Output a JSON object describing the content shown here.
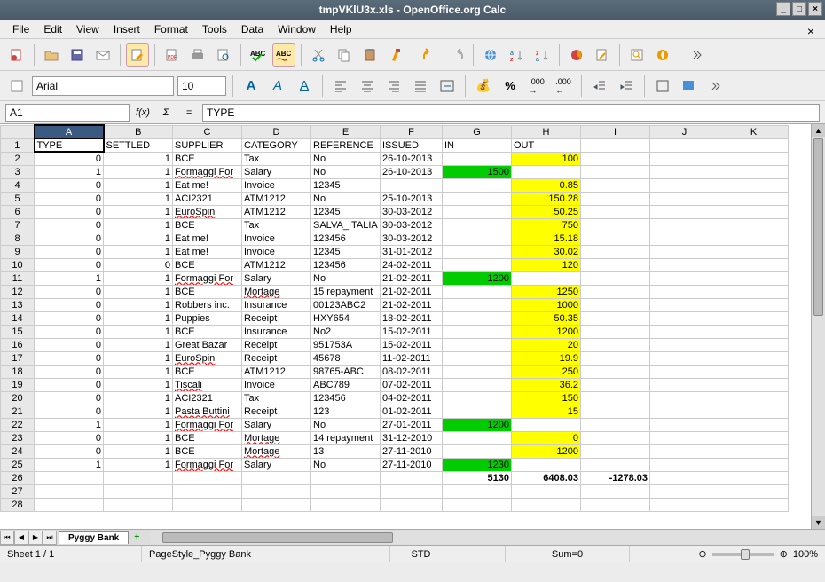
{
  "window": {
    "title": "tmpVKlU3x.xls - OpenOffice.org Calc"
  },
  "menu": {
    "file": "File",
    "edit": "Edit",
    "view": "View",
    "insert": "Insert",
    "format": "Format",
    "tools": "Tools",
    "data": "Data",
    "window": "Window",
    "help": "Help"
  },
  "format": {
    "font": "Arial",
    "size": "10"
  },
  "formula": {
    "ref": "A1",
    "value": "TYPE"
  },
  "cols": [
    "A",
    "B",
    "C",
    "D",
    "E",
    "F",
    "G",
    "H",
    "I",
    "J",
    "K"
  ],
  "headers": {
    "A": "TYPE",
    "B": "SETTLED",
    "C": "SUPPLIER",
    "D": "CATEGORY",
    "E": "REFERENCE",
    "F": "ISSUED",
    "G": "IN",
    "H": "OUT"
  },
  "rows": [
    {
      "n": 2,
      "A": "0",
      "B": "1",
      "C": "BCE",
      "D": "Tax",
      "E": "No",
      "F": "26-10-2013",
      "H": "100",
      "Hc": "yellow"
    },
    {
      "n": 3,
      "A": "1",
      "B": "1",
      "C": "Formaggi For",
      "D": "Salary",
      "E": "No",
      "F": "26-10-2013",
      "G": "1500",
      "Gc": "green",
      "Cspell": true
    },
    {
      "n": 4,
      "A": "0",
      "B": "1",
      "C": "Eat me!",
      "D": "Invoice",
      "E": "12345",
      "H": "0.85",
      "Hc": "yellow"
    },
    {
      "n": 5,
      "A": "0",
      "B": "1",
      "C": "ACI2321",
      "D": "ATM1212",
      "E": "No",
      "F": "25-10-2013",
      "H": "150.28",
      "Hc": "yellow"
    },
    {
      "n": 6,
      "A": "0",
      "B": "1",
      "C": "EuroSpin",
      "D": "ATM1212",
      "E": "12345",
      "F": "30-03-2012",
      "H": "50.25",
      "Hc": "yellow",
      "Cspell": true
    },
    {
      "n": 7,
      "A": "0",
      "B": "1",
      "C": "BCE",
      "D": "Tax",
      "E": "SALVA_ITALIA",
      "F": "30-03-2012",
      "H": "750",
      "Hc": "yellow"
    },
    {
      "n": 8,
      "A": "0",
      "B": "1",
      "C": "Eat me!",
      "D": "Invoice",
      "E": "123456",
      "F": "30-03-2012",
      "H": "15.18",
      "Hc": "yellow"
    },
    {
      "n": 9,
      "A": "0",
      "B": "1",
      "C": "Eat me!",
      "D": "Invoice",
      "E": "12345",
      "F": "31-01-2012",
      "H": "30.02",
      "Hc": "yellow"
    },
    {
      "n": 10,
      "A": "0",
      "B": "0",
      "C": "BCE",
      "D": "ATM1212",
      "E": "123456",
      "F": "24-02-2011",
      "H": "120",
      "Hc": "yellow"
    },
    {
      "n": 11,
      "A": "1",
      "B": "1",
      "C": "Formaggi For",
      "D": "Salary",
      "E": "No",
      "F": "21-02-2011",
      "G": "1200",
      "Gc": "green",
      "Cspell": true
    },
    {
      "n": 12,
      "A": "0",
      "B": "1",
      "C": "BCE",
      "D": "Mortage",
      "E": "15 repayment",
      "F": "21-02-2011",
      "H": "1250",
      "Hc": "yellow",
      "Dspell": true
    },
    {
      "n": 13,
      "A": "0",
      "B": "1",
      "C": "Robbers inc.",
      "D": "Insurance",
      "E": "00123ABC2",
      "F": "21-02-2011",
      "H": "1000",
      "Hc": "yellow"
    },
    {
      "n": 14,
      "A": "0",
      "B": "1",
      "C": "Puppies",
      "D": "Receipt",
      "E": "HXY654",
      "F": "18-02-2011",
      "H": "50.35",
      "Hc": "yellow"
    },
    {
      "n": 15,
      "A": "0",
      "B": "1",
      "C": "BCE",
      "D": "Insurance",
      "E": "No2",
      "F": "15-02-2011",
      "H": "1200",
      "Hc": "yellow"
    },
    {
      "n": 16,
      "A": "0",
      "B": "1",
      "C": "Great Bazar",
      "D": "Receipt",
      "E": "951753A",
      "F": "15-02-2011",
      "H": "20",
      "Hc": "yellow"
    },
    {
      "n": 17,
      "A": "0",
      "B": "1",
      "C": "EuroSpin",
      "D": "Receipt",
      "E": "45678",
      "F": "11-02-2011",
      "H": "19.9",
      "Hc": "yellow",
      "Cspell": true
    },
    {
      "n": 18,
      "A": "0",
      "B": "1",
      "C": "BCE",
      "D": "ATM1212",
      "E": "98765-ABC",
      "F": "08-02-2011",
      "H": "250",
      "Hc": "yellow"
    },
    {
      "n": 19,
      "A": "0",
      "B": "1",
      "C": "Tiscali",
      "D": "Invoice",
      "E": "ABC789",
      "F": "07-02-2011",
      "H": "36.2",
      "Hc": "yellow",
      "Cspell": true
    },
    {
      "n": 20,
      "A": "0",
      "B": "1",
      "C": "ACI2321",
      "D": "Tax",
      "E": "123456",
      "F": "04-02-2011",
      "H": "150",
      "Hc": "yellow"
    },
    {
      "n": 21,
      "A": "0",
      "B": "1",
      "C": "Pasta Buttini",
      "D": "Receipt",
      "E": "123",
      "F": "01-02-2011",
      "H": "15",
      "Hc": "yellow",
      "Cspell": true
    },
    {
      "n": 22,
      "A": "1",
      "B": "1",
      "C": "Formaggi For",
      "D": "Salary",
      "E": "No",
      "F": "27-01-2011",
      "G": "1200",
      "Gc": "green",
      "Cspell": true
    },
    {
      "n": 23,
      "A": "0",
      "B": "1",
      "C": "BCE",
      "D": "Mortage",
      "E": "14 repayment",
      "F": "31-12-2010",
      "H": "0",
      "Hc": "yellow",
      "Dspell": true
    },
    {
      "n": 24,
      "A": "0",
      "B": "1",
      "C": "BCE",
      "D": "Mortage",
      "E": "13",
      "F": "27-11-2010",
      "H": "1200",
      "Hc": "yellow",
      "Dspell": true
    },
    {
      "n": 25,
      "A": "1",
      "B": "1",
      "C": "Formaggi For",
      "D": "Salary",
      "E": "No",
      "F": "27-11-2010",
      "G": "1230",
      "Gc": "green",
      "Cspell": true
    },
    {
      "n": 26,
      "G": "5130",
      "H": "6408.03",
      "I": "-1278.03",
      "bold": true
    },
    {
      "n": 27
    },
    {
      "n": 28
    }
  ],
  "tab": {
    "name": "Pyggy Bank"
  },
  "status": {
    "sheet": "Sheet 1 / 1",
    "style": "PageStyle_Pyggy Bank",
    "mode": "STD",
    "sum": "Sum=0",
    "zoom": "100%"
  }
}
